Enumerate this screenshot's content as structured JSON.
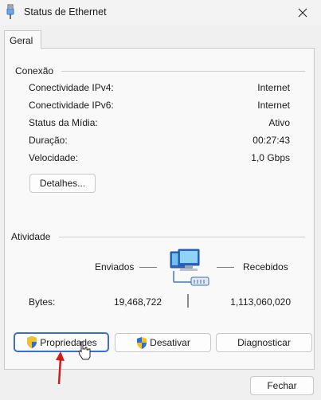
{
  "window": {
    "title": "Status de Ethernet",
    "icon": "network-adapter-icon"
  },
  "tabs": [
    {
      "label": "Geral"
    }
  ],
  "connection": {
    "section_label": "Conexão",
    "rows": [
      {
        "label": "Conectividade IPv4:",
        "value": "Internet"
      },
      {
        "label": "Conectividade IPv6:",
        "value": "Internet"
      },
      {
        "label": "Status da Mídia:",
        "value": "Ativo"
      },
      {
        "label": "Duração:",
        "value": "00:27:43"
      },
      {
        "label": "Velocidade:",
        "value": "1,0 Gbps"
      }
    ],
    "details_button": "Detalhes..."
  },
  "activity": {
    "section_label": "Atividade",
    "sent_label": "Enviados",
    "received_label": "Recebidos",
    "bytes_label": "Bytes:",
    "bytes_sent": "19,468,722",
    "bytes_received": "1,113,060,020",
    "icon": "network-computers-icon"
  },
  "buttons": {
    "properties": "Propriedades",
    "disable": "Desativar",
    "diagnose": "Diagnosticar",
    "close": "Fechar"
  },
  "colors": {
    "focus_border": "#3b6ed3",
    "annotation_arrow": "#d11a1a"
  }
}
